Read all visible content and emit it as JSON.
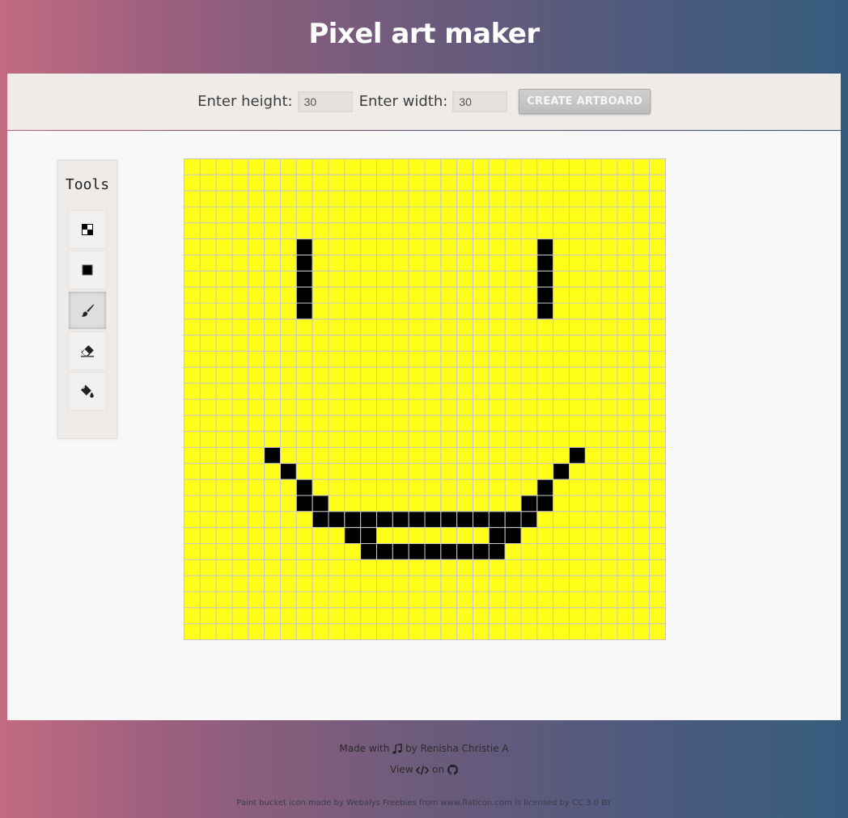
{
  "header": {
    "title": "Pixel art maker"
  },
  "controls": {
    "height_label": "Enter height:",
    "height_value": "30",
    "width_label": "Enter width:",
    "width_value": "30",
    "create_label": "CREATE ARTBOARD"
  },
  "tools": {
    "title": "Tools",
    "items": [
      {
        "icon": "grid-toggle-icon",
        "active": false
      },
      {
        "icon": "square-icon",
        "active": false
      },
      {
        "icon": "brush-icon",
        "active": true
      },
      {
        "icon": "eraser-icon",
        "active": false
      },
      {
        "icon": "paint-bucket-icon",
        "active": false
      }
    ]
  },
  "artboard": {
    "rows": 30,
    "cols": 30,
    "fill_color": "#ffff1a",
    "paint_color": "#000000",
    "grid_color": "#c8c8c8",
    "painted_cells": [
      [
        5,
        7
      ],
      [
        6,
        7
      ],
      [
        7,
        7
      ],
      [
        8,
        7
      ],
      [
        9,
        7
      ],
      [
        5,
        22
      ],
      [
        6,
        22
      ],
      [
        7,
        22
      ],
      [
        8,
        22
      ],
      [
        9,
        22
      ],
      [
        18,
        5
      ],
      [
        19,
        6
      ],
      [
        20,
        7
      ],
      [
        21,
        7
      ],
      [
        21,
        8
      ],
      [
        22,
        8
      ],
      [
        22,
        9
      ],
      [
        22,
        10
      ],
      [
        22,
        11
      ],
      [
        22,
        12
      ],
      [
        22,
        13
      ],
      [
        22,
        14
      ],
      [
        22,
        15
      ],
      [
        22,
        16
      ],
      [
        22,
        17
      ],
      [
        22,
        18
      ],
      [
        22,
        19
      ],
      [
        22,
        20
      ],
      [
        22,
        21
      ],
      [
        23,
        10
      ],
      [
        23,
        11
      ],
      [
        23,
        19
      ],
      [
        23,
        20
      ],
      [
        24,
        11
      ],
      [
        24,
        12
      ],
      [
        24,
        13
      ],
      [
        24,
        14
      ],
      [
        24,
        15
      ],
      [
        24,
        16
      ],
      [
        24,
        17
      ],
      [
        24,
        18
      ],
      [
        24,
        19
      ],
      [
        18,
        24
      ],
      [
        19,
        23
      ],
      [
        20,
        22
      ],
      [
        21,
        21
      ],
      [
        21,
        22
      ]
    ]
  },
  "footer": {
    "made_prefix": "Made with",
    "made_suffix": "by Renisha Christie A",
    "view_prefix": "View",
    "view_suffix": "on",
    "credit": "Paint bucket icon made by Webalys Freebies from www.flaticon.com is licensed by CC 3.0 BY"
  }
}
